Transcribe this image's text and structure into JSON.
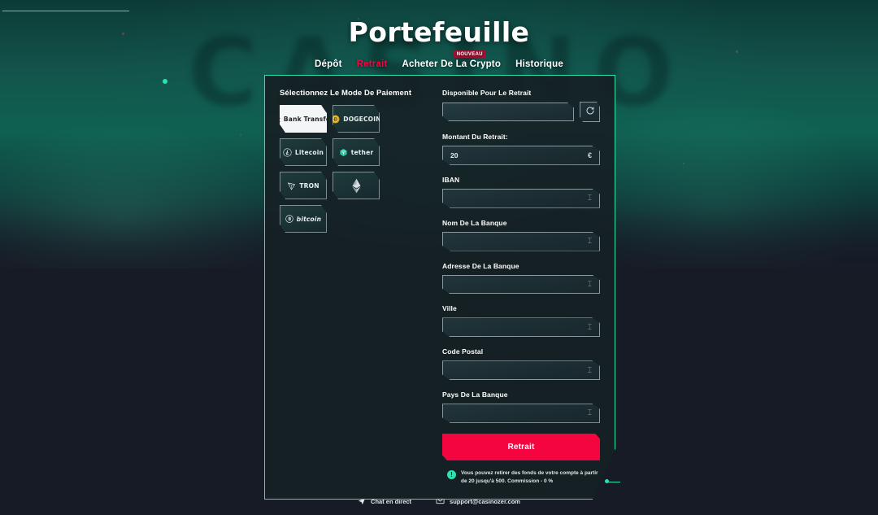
{
  "header": {
    "title": "Portefeuille",
    "nav": [
      {
        "label": "Dépôt",
        "active": false,
        "badge": ""
      },
      {
        "label": "Retrait",
        "active": true,
        "badge": ""
      },
      {
        "label": "Acheter De La Crypto",
        "active": false,
        "badge": "NOUVEAU"
      },
      {
        "label": "Historique",
        "active": false,
        "badge": ""
      }
    ]
  },
  "background": {
    "watermark": "CASINO"
  },
  "payment": {
    "section_label": "Sélectionnez Le Mode De Paiement",
    "methods": [
      {
        "label": "Bank Transfer",
        "icon": "bank-icon",
        "selected": true
      },
      {
        "label": "DOGECOIN",
        "icon": "dogecoin-icon",
        "selected": false
      },
      {
        "label": "Litecoin",
        "icon": "litecoin-icon",
        "selected": false
      },
      {
        "label": "tether",
        "icon": "tether-icon",
        "selected": false
      },
      {
        "label": "TRON",
        "icon": "tron-icon",
        "selected": false
      },
      {
        "label": "",
        "icon": "ethereum-icon",
        "selected": false
      },
      {
        "label": "bitcoin",
        "icon": "bitcoin-icon",
        "selected": false
      }
    ]
  },
  "form": {
    "available": {
      "label": "Disponible Pour Le Retrait",
      "value": "",
      "placeholder": ""
    },
    "refresh_icon": "refresh-icon",
    "amount": {
      "label": "Montant Du Retrait:",
      "value": "20",
      "placeholder": "",
      "suffix": "€"
    },
    "iban": {
      "label": "IBAN",
      "value": "",
      "placeholder": ""
    },
    "bank_name": {
      "label": "Nom De La Banque",
      "value": "",
      "placeholder": ""
    },
    "bank_address": {
      "label": "Adresse De La Banque",
      "value": "",
      "placeholder": ""
    },
    "city": {
      "label": "Ville",
      "value": "",
      "placeholder": ""
    },
    "postal_code": {
      "label": "Code Postal",
      "value": "",
      "placeholder": ""
    },
    "bank_country": {
      "label": "Pays De La Banque",
      "value": "",
      "placeholder": ""
    },
    "submit_label": "Retrait",
    "info_text": "Vous pouvez retirer des fonds de votre compte à partir de 20 jusqu'à 500. Commission - 0 %"
  },
  "footer": {
    "chat": {
      "label": "Chat en direct",
      "icon": "paper-plane-icon"
    },
    "email": {
      "label": "support@casinozer.com",
      "icon": "envelope-icon"
    }
  },
  "colors": {
    "accent_teal": "#2de2b0",
    "accent_pink": "#f5053f",
    "panel_bg": "#152025",
    "page_bg": "#171b26",
    "badge_red": "#9d1234"
  }
}
